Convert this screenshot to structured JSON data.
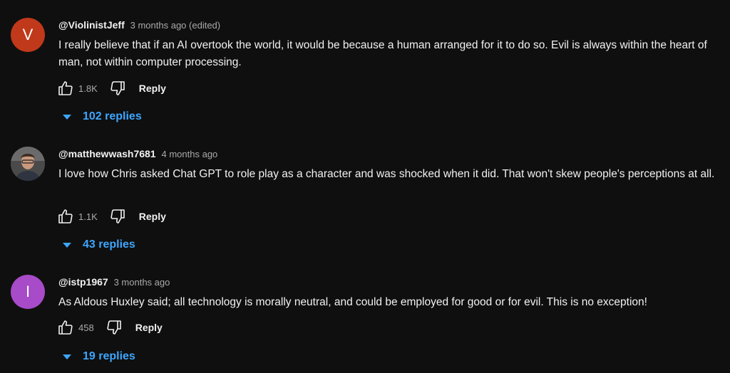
{
  "comments": [
    {
      "author": "@ViolinistJeff",
      "meta": "3 months ago (edited)",
      "avatar_letter": "V",
      "avatar_color": "#c0391a",
      "text": "I really believe that if an AI overtook the world, it would be because a human arranged for it to do so. Evil is always within the heart of man, not within computer processing.",
      "likes": "1.8K",
      "reply_label": "Reply",
      "replies": "102 replies"
    },
    {
      "author": "@matthewwash7681",
      "meta": "4 months ago",
      "avatar_letter": "",
      "avatar_color": "#3a3a3a",
      "text": "I love how Chris asked Chat GPT to role play as a character and was shocked when it did. That won't skew people's perceptions at all.",
      "likes": "1.1K",
      "reply_label": "Reply",
      "replies": "43 replies"
    },
    {
      "author": "@istp1967",
      "meta": "3 months ago",
      "avatar_letter": "I",
      "avatar_color": "#a74bc8",
      "text": "As Aldous Huxley said; all technology is morally neutral, and could be employed for good or for evil.  This is no exception!",
      "likes": "458",
      "reply_label": "Reply",
      "replies": "19 replies"
    }
  ],
  "icons": {
    "like": "thumbs-up-icon",
    "dislike": "thumbs-down-icon",
    "expand": "caret-down-icon"
  }
}
